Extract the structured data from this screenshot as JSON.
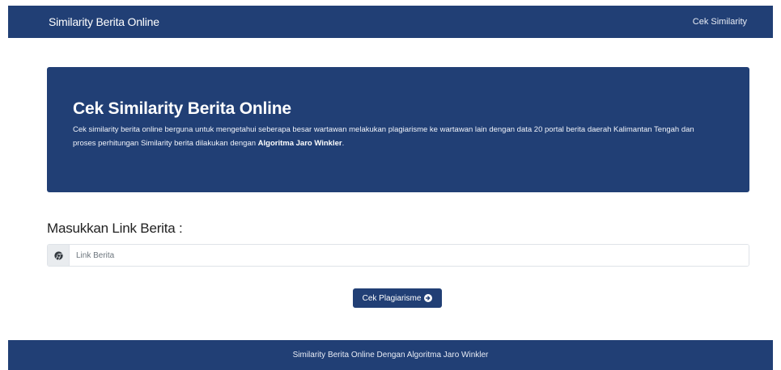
{
  "navbar": {
    "brand": "Similarity Berita Online",
    "link": "Cek Similarity"
  },
  "hero": {
    "title": "Cek Similarity Berita Online",
    "text_before_bold": "Cek similarity berita online berguna untuk mengetahui seberapa besar wartawan melakukan plagiarisme ke wartawan lain dengan data 20 portal berita daerah Kalimantan Tengah dan proses perhitungan Similarity berita dilakukan dengan ",
    "text_bold": "Algoritma Jaro Winkler",
    "text_after_bold": "."
  },
  "form": {
    "label": "Masukkan Link Berita :",
    "input_icon": "chrome-icon",
    "input_placeholder": "Link Berita",
    "input_value": "",
    "submit_label": "Cek Plagiarisme",
    "submit_icon": "arrow-circle-right-icon"
  },
  "footer": {
    "text": "Similarity Berita Online Dengan Algoritma Jaro Winkler"
  },
  "colors": {
    "primary": "#213f75",
    "white": "#ffffff"
  }
}
